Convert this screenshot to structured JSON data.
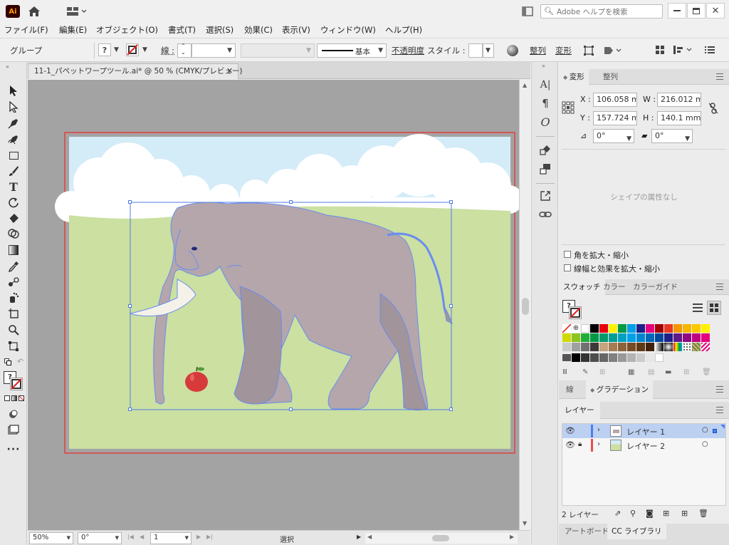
{
  "app": {
    "logo": "Ai",
    "search_placeholder": "Adobe ヘルプを検索"
  },
  "menu": [
    "ファイル(F)",
    "編集(E)",
    "オブジェクト(O)",
    "書式(T)",
    "選択(S)",
    "効果(C)",
    "表示(V)",
    "ウィンドウ(W)",
    "ヘルプ(H)"
  ],
  "control": {
    "selection_label": "グループ",
    "stroke_label": "線 :",
    "brush_value": "基本",
    "opacity_label": "不透明度",
    "style_label": "スタイル :",
    "align_link": "整列",
    "transform_link": "変形"
  },
  "document": {
    "tab_title": "11-1_パペットワープツール.ai* @ 50 % (CMYK/プレビュー)"
  },
  "status": {
    "zoom": "50%",
    "rotation": "0°",
    "artboard": "1",
    "mode": "選択"
  },
  "transform_panel": {
    "tabs": [
      "変形",
      "整列"
    ],
    "x_label": "X :",
    "x": "106.058 m",
    "y_label": "Y :",
    "y": "157.724 m",
    "w_label": "W :",
    "w": "216.012 m",
    "h_label": "H :",
    "h": "140.1 mm",
    "angle": "0°",
    "shear": "0°",
    "no_shape": "シェイプの属性なし",
    "scale_corners": "角を拡大・縮小",
    "scale_strokes": "線幅と効果を拡大・縮小"
  },
  "swatches_panel": {
    "tabs": [
      "スウォッチ",
      "カラー",
      "カラーガイド"
    ]
  },
  "stroke_panel": {
    "tabs": [
      "線",
      "グラデーション"
    ]
  },
  "layers_panel": {
    "tab": "レイヤー",
    "layers": [
      {
        "name": "レイヤー 1",
        "color": "#4a7ef0",
        "selected": true
      },
      {
        "name": "レイヤー 2",
        "color": "#f04a4a",
        "selected": false
      }
    ],
    "count": "2 レイヤー"
  },
  "bottom_tabs": [
    "アートボード",
    "CC ライブラリ"
  ],
  "colors": {
    "accent": "#4f7be6",
    "sky": "#d4ecf8",
    "grass": "#cbe0a1",
    "elephant": "#b4a6ab",
    "apple": "#d63a3a"
  }
}
